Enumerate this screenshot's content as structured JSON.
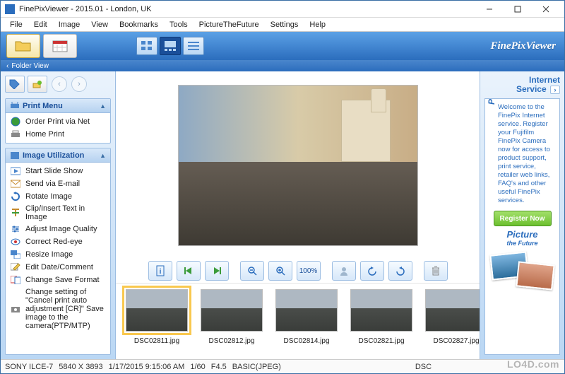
{
  "app": {
    "name": "FinePixViewer"
  },
  "window": {
    "title": "FinePixViewer  - 2015.01 - London, UK"
  },
  "menu": [
    "File",
    "Edit",
    "Image",
    "View",
    "Bookmarks",
    "Tools",
    "PictureTheFuture",
    "Settings",
    "Help"
  ],
  "toolbar": {
    "folder_view_label": "Folder View",
    "brand": "FinePixViewer"
  },
  "print_menu": {
    "title": "Print Menu",
    "items": [
      {
        "label": "Order Print via Net"
      },
      {
        "label": "Home Print"
      }
    ]
  },
  "image_util": {
    "title": "Image Utilization",
    "items": [
      {
        "label": "Start Slide Show"
      },
      {
        "label": "Send via E-mail"
      },
      {
        "label": "Rotate Image"
      },
      {
        "label": "Clip/Insert Text in Image"
      },
      {
        "label": "Adjust Image Quality"
      },
      {
        "label": "Correct Red-eye"
      },
      {
        "label": "Resize Image"
      },
      {
        "label": "Edit Date/Comment"
      },
      {
        "label": "Change Save Format"
      },
      {
        "label": "Change setting of  \"Cancel print auto adjustment [CR]\" Save image to the camera(PTP/MTP)"
      }
    ]
  },
  "viewer_tools": {
    "zoom_label": "100%"
  },
  "thumbnails": [
    {
      "filename": "DSC02811.jpg",
      "selected": true
    },
    {
      "filename": "DSC02812.jpg",
      "selected": false
    },
    {
      "filename": "DSC02814.jpg",
      "selected": false
    },
    {
      "filename": "DSC02821.jpg",
      "selected": false
    },
    {
      "filename": "DSC02827.jpg",
      "selected": false
    }
  ],
  "right_panel": {
    "title_line1": "Internet",
    "title_line2": "Service",
    "vertical_label": "Picture the Future",
    "description": "Welcome to the FinePix Internet service. Register your Fujifilm FinePix Camera now for access to product support, print service, retailer web links, FAQ's and other useful FinePix services.",
    "register_label": "Register Now",
    "ptf_line1": "Picture",
    "ptf_line2": "the Future"
  },
  "statusbar": {
    "camera": "SONY ILCE-7",
    "dimensions": "5840 X 3893",
    "datetime": "1/17/2015 9:15:06 AM",
    "shutter": "1/60",
    "aperture": "F4.5",
    "format": "BASIC(JPEG)",
    "prefix": "DSC"
  },
  "watermark": "LO4D.com"
}
